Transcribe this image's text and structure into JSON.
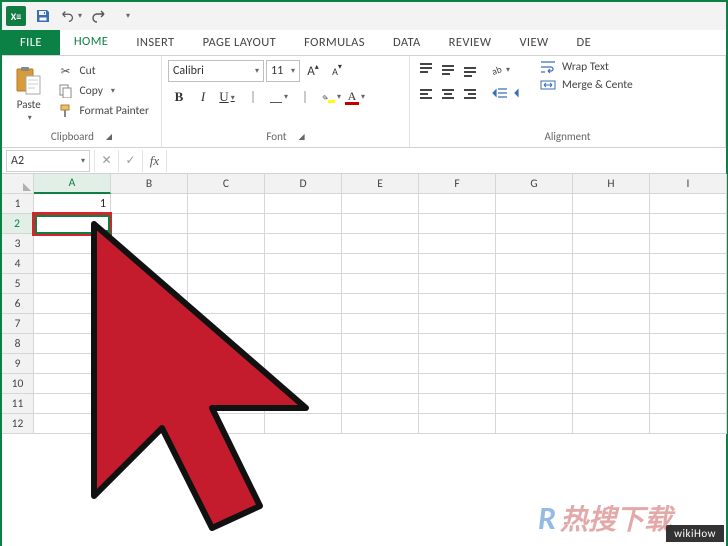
{
  "qat": {
    "save": "save-icon",
    "undo": "undo-icon",
    "redo": "redo-icon"
  },
  "tabs": {
    "file": "FILE",
    "home": "HOME",
    "insert": "INSERT",
    "page_layout": "PAGE LAYOUT",
    "formulas": "FORMULAS",
    "data": "DATA",
    "review": "REVIEW",
    "view": "VIEW",
    "de": "DE"
  },
  "ribbon": {
    "clipboard": {
      "paste": "Paste",
      "cut": "Cut",
      "copy": "Copy",
      "format_painter": "Format Painter",
      "label": "Clipboard"
    },
    "font": {
      "name": "Calibri",
      "size": "11",
      "grow": "A",
      "shrink": "A",
      "bold": "B",
      "italic": "I",
      "underline": "U",
      "font_color_letter": "A",
      "label": "Font"
    },
    "alignment": {
      "wrap_text": "Wrap Text",
      "merge_center": "Merge & Cente",
      "label": "Alignment"
    }
  },
  "formula_bar": {
    "name_box": "A2",
    "cancel": "✕",
    "enter": "✓",
    "fx": "fx",
    "value": ""
  },
  "grid": {
    "columns": [
      "A",
      "B",
      "C",
      "D",
      "E",
      "F",
      "G",
      "H",
      "I"
    ],
    "rows": [
      "1",
      "2",
      "3",
      "4",
      "5",
      "6",
      "7",
      "8",
      "9",
      "10",
      "11",
      "12"
    ],
    "active_col": "A",
    "active_row": "2",
    "cells": {
      "A1": "1"
    }
  },
  "watermarks": {
    "primary": "热搜下载",
    "primary_prefix": "R",
    "secondary": "wikiHow"
  }
}
